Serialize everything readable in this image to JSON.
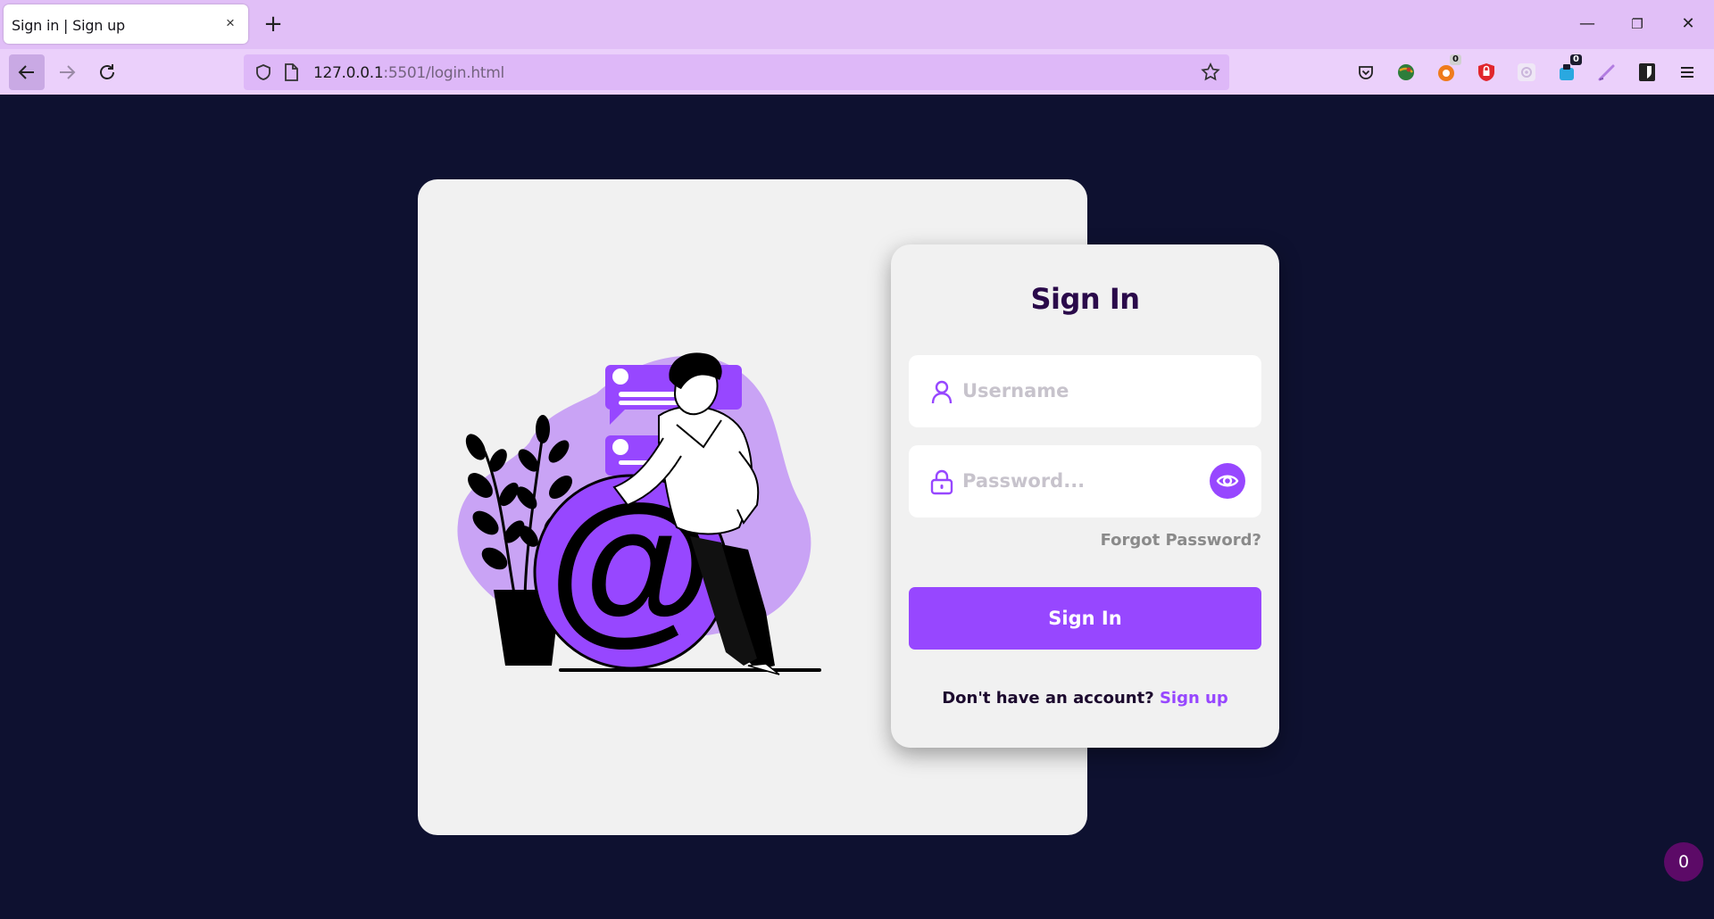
{
  "browser": {
    "tab_title": "Sign in | Sign up",
    "tab_close": "×",
    "new_tab": "+",
    "url_host": "127.0.0.1",
    "url_rest": ":5501/login.html",
    "window_buttons": {
      "minimize": "—",
      "restore": "❐",
      "close": "✕"
    },
    "extensions": [
      {
        "name": "pocket-icon"
      },
      {
        "name": "globe-extension-icon"
      },
      {
        "name": "orange-extension-icon",
        "badge": "0"
      },
      {
        "name": "ublock-icon"
      },
      {
        "name": "gear-extension-icon"
      },
      {
        "name": "blue-extension-icon",
        "badge": "0"
      },
      {
        "name": "pen-extension-icon"
      },
      {
        "name": "bitwarden-icon"
      },
      {
        "name": "hamburger-menu-icon"
      }
    ]
  },
  "login": {
    "title": "Sign In",
    "username_placeholder": "Username",
    "password_placeholder": "Password...",
    "forgot_password": "Forgot Password?",
    "submit_label": "Sign In",
    "signup_prompt": "Don't have an account?",
    "signup_link": "Sign up"
  },
  "counter": "0",
  "colors": {
    "accent": "#9747ff",
    "page_background": "#0e1130",
    "card_background": "#f1f1f1",
    "title": "#2a0a4a",
    "chrome_tabbar": "#e1bff7",
    "chrome_navbar": "#ebd0fb"
  }
}
